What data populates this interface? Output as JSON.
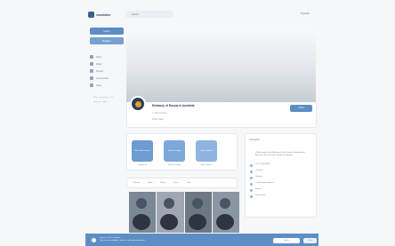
{
  "header": {
    "brand": "vkontakte",
    "search_placeholder": "Search",
    "language": "Русский"
  },
  "sidebar": {
    "primary_button": "Log in",
    "secondary_button": "Register",
    "items": [
      {
        "label": "News"
      },
      {
        "label": "Music"
      },
      {
        "label": "Friends"
      },
      {
        "label": "Communities"
      },
      {
        "label": "Video"
      }
    ],
    "footer_links": "Blog · Developers · For business · More"
  },
  "profile": {
    "title": "Embassy of Russia in Australia",
    "members": "1 745 members",
    "category": "Public page"
  },
  "actions": {
    "follow": "Follow",
    "items": [
      {
        "label": "Subscribe to news",
        "caption": "Contact us",
        "color": "#6e9bd0"
      },
      {
        "label": "Send message",
        "caption": "Send message",
        "color": "#7ea8d9"
      },
      {
        "label": "Open website",
        "caption": "Open website",
        "color": "#8fb4df"
      }
    ]
  },
  "tabs": [
    "Photos",
    "Video",
    "Music",
    "Posts",
    "Links"
  ],
  "info": {
    "header": "Information",
    "description": "Official page of the Embassy of the Russian Federation in Australia and Consulate General in Sydney",
    "rows": [
      "+61 2 6295 9033",
      "Contacts",
      "Website",
      "Community members",
      "Follow",
      "Show more"
    ]
  },
  "banner": {
    "text": "Log in to VK to continue",
    "subtitle": "Sign in to see updates, photos, and community news",
    "primary": "Sign in",
    "secondary": "Close"
  }
}
